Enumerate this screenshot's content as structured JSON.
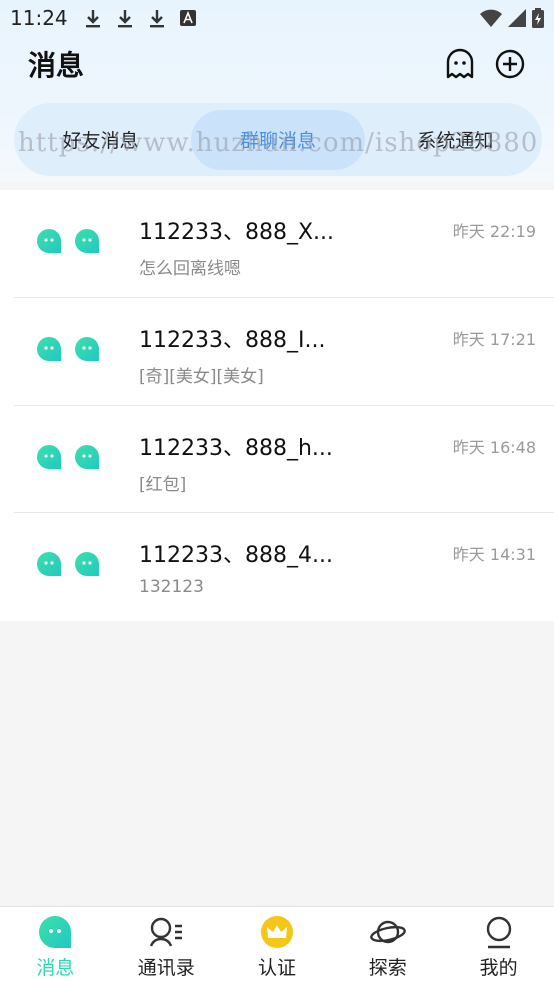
{
  "status_bar": {
    "time": "11:24"
  },
  "header": {
    "title": "消息"
  },
  "segments": [
    {
      "label": "好友消息",
      "active": false
    },
    {
      "label": "群聊消息",
      "active": true
    },
    {
      "label": "系统通知",
      "active": false
    }
  ],
  "watermark": "https://www.huzhan.com/ishop28880",
  "conversations": [
    {
      "name": "112233、888_X...",
      "message": "怎么回离线嗯",
      "time": "昨天 22:19"
    },
    {
      "name": "112233、888_I...",
      "message": "[奇][美女][美女]",
      "time": "昨天 17:21"
    },
    {
      "name": "112233、888_h...",
      "message": "[红包]",
      "time": "昨天 16:48"
    },
    {
      "name": "112233、888_4...",
      "message": "132123",
      "time": "昨天 14:31"
    }
  ],
  "tabbar": [
    {
      "label": "消息",
      "icon": "chat-bubble-icon",
      "active": true
    },
    {
      "label": "通讯录",
      "icon": "contacts-icon",
      "active": false
    },
    {
      "label": "认证",
      "icon": "crown-icon",
      "active": false
    },
    {
      "label": "探索",
      "icon": "planet-icon",
      "active": false
    },
    {
      "label": "我的",
      "icon": "profile-icon",
      "active": false
    }
  ],
  "colors": {
    "accent": "#2ed8b4",
    "segment_active_text": "#4a90e2",
    "crown": "#f5c518"
  }
}
